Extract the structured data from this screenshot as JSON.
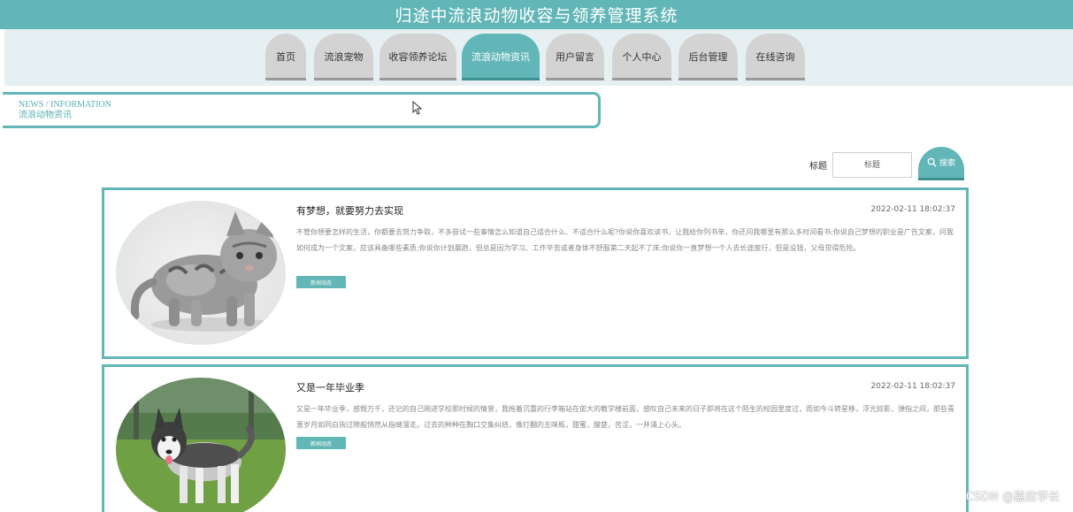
{
  "header": {
    "title": "归途中流浪动物收容与领养管理系统"
  },
  "nav": {
    "items": [
      {
        "label": "首页",
        "active": false
      },
      {
        "label": "流浪宠物",
        "active": false
      },
      {
        "label": "收容领养论坛",
        "active": false
      },
      {
        "label": "流浪动物资讯",
        "active": true
      },
      {
        "label": "用户留言",
        "active": false
      },
      {
        "label": "个人中心",
        "active": false
      },
      {
        "label": "后台管理",
        "active": false
      },
      {
        "label": "在线咨询",
        "active": false
      }
    ]
  },
  "breadcrumb": {
    "en": "NEWS / INFORMATION",
    "cn": "流浪动物资讯"
  },
  "search": {
    "label": "标题",
    "placeholder": "标题",
    "button_label": "搜索"
  },
  "news": [
    {
      "title": "有梦想，就要努力去实现",
      "time": "2022-02-11 18:02:37",
      "desc": "不管你想要怎样的生活，你都要去努力争取，不多尝试一些事情怎么知道自己适合什么、不适合什么呢?你说你喜欢读书，让我给你列书单，你还问我哪里有那么多时间看书;你说自己梦想的职业是广告文案，问我如何成为一个文案，应该具备哪些素质;你说你计划晨跑，但总是因为学习、工作辛苦或者身体不舒服第二天起不了床;你说你一直梦想一个人去长途旅行，但是没钱，父母觉得危险。",
      "tag": "新闻动态",
      "image": "cat"
    },
    {
      "title": "又是一年毕业季",
      "time": "2022-02-11 18:02:37",
      "desc": "又是一年毕业季，感慨万千，还记的自己刚进学校那时候的情景，我拖着沉重的行李箱站在偌大的教学楼前面，感叹自己未来的日子即将在这个陌生的校园里度过，而如今斗转星移，浮光掠影，弹指之间，那些青葱岁月如同白驹过隙般悄然从指缝溜走。过去的种种在胸口交集纠结，像打翻的五味瓶，甜蜜，酸楚，苦涩，一并涌上心头。",
      "tag": "新闻动态",
      "image": "husky"
    }
  ],
  "watermark": "CSDN @嘉应学长",
  "colors": {
    "accent": "#62b6b7",
    "nav_bg": "#e6f0f3",
    "tab_inactive": "#d3d3d3"
  }
}
